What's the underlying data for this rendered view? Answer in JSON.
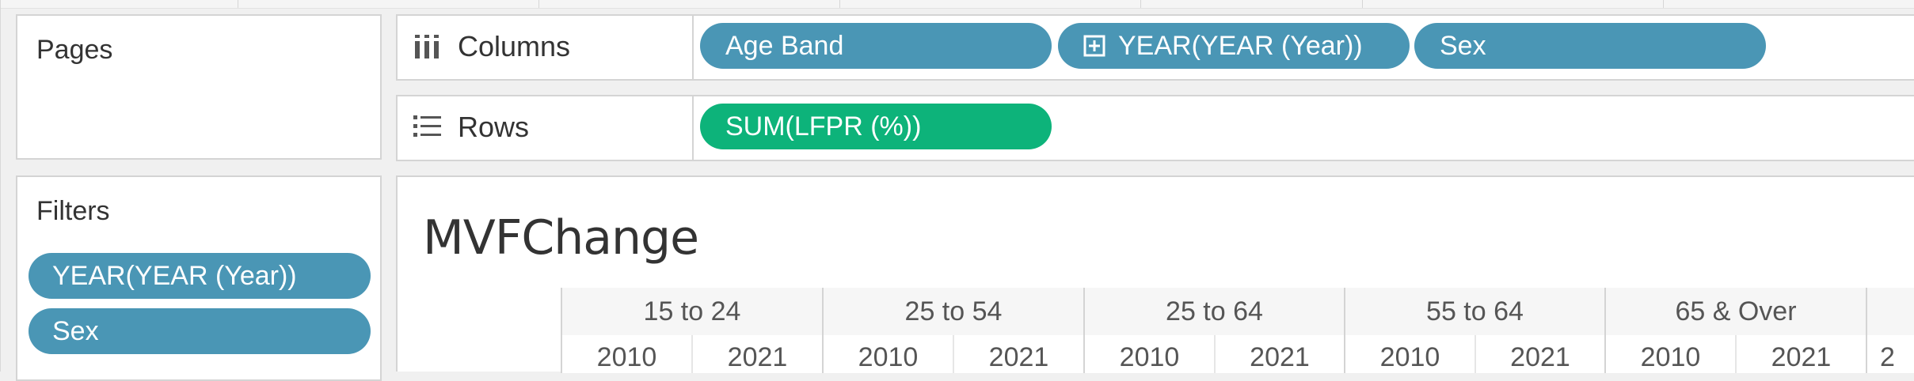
{
  "pages_card": {
    "title": "Pages"
  },
  "filters_card": {
    "title": "Filters",
    "pills": [
      "YEAR(YEAR (Year))",
      "Sex"
    ]
  },
  "columns_shelf": {
    "label": "Columns",
    "icon": "columns-icon",
    "pills": [
      "Age Band",
      "YEAR(YEAR (Year))",
      "Sex"
    ],
    "expand_icon": "plus-square-icon"
  },
  "rows_shelf": {
    "label": "Rows",
    "icon": "rows-list-icon",
    "pills": [
      "SUM(LFPR (%))"
    ]
  },
  "view": {
    "title": "MVFChange",
    "age_groups": [
      "15 to 24",
      "25 to 54",
      "25 to 64",
      "55 to 64",
      "65 & Over"
    ],
    "years": [
      "2010",
      "2021",
      "2010",
      "2021",
      "2010",
      "2021",
      "2010",
      "2021",
      "2010",
      "2021",
      "2"
    ]
  },
  "colors": {
    "dimension_pill": "#4a96b5",
    "measure_pill": "#0db37a",
    "card_border": "#d4d4d4",
    "background": "#f0f0f0"
  }
}
